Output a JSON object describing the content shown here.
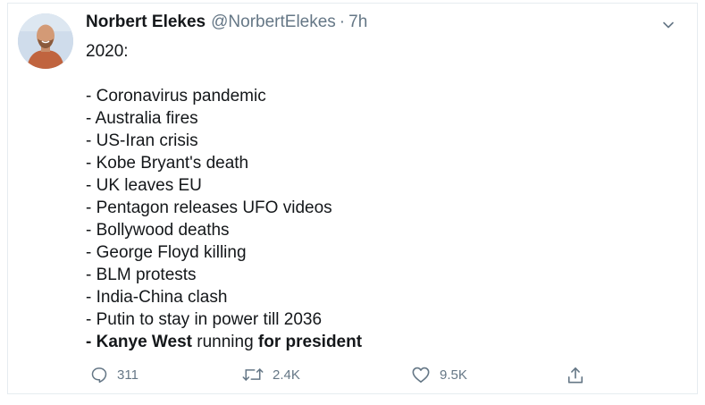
{
  "tweet": {
    "author": {
      "display_name": "Norbert Elekes",
      "handle": "@NorbertElekes"
    },
    "separator": "·",
    "timestamp": "7h",
    "text": {
      "intro": "2020:",
      "items": [
        "- Coronavirus pandemic",
        "- Australia fires",
        "- US-Iran crisis",
        "- Kobe Bryant's death",
        "- UK leaves EU",
        "- Pentagon releases UFO videos",
        "- Bollywood deaths",
        "- George Floyd killing",
        "- BLM protests",
        "- India-China clash",
        "- Putin to stay in power till 2036"
      ],
      "last_item": {
        "prefix": "- Kanye West",
        "middle": " running ",
        "suffix": "for president"
      }
    },
    "actions": {
      "reply_count": "311",
      "retweet_count": "2.4K",
      "like_count": "9.5K"
    }
  },
  "icons": {
    "menu": "chevron-down-icon",
    "reply": "speech-bubble-icon",
    "retweet": "retweet-arrows-icon",
    "like": "heart-outline-icon",
    "share": "share-upload-icon"
  },
  "colors": {
    "text": "#14171a",
    "secondary": "#657786",
    "border": "#e6ecf0"
  }
}
